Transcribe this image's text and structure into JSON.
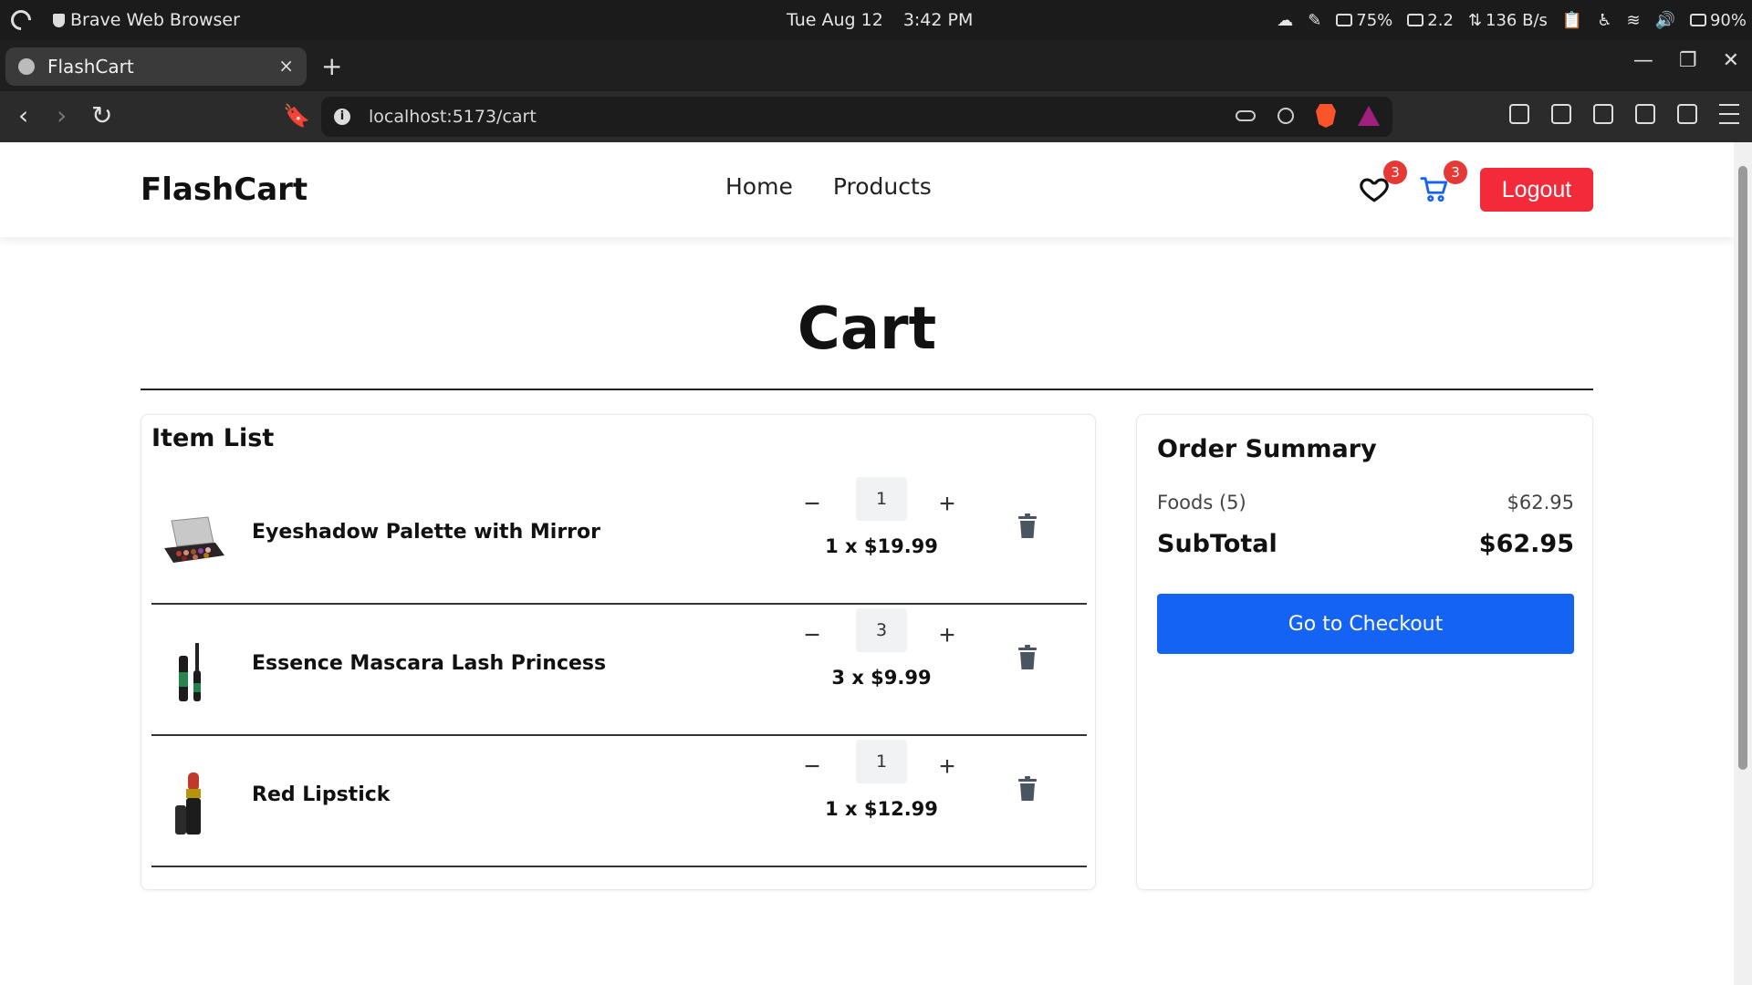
{
  "os": {
    "app_name": "Brave Web Browser",
    "date": "Tue Aug 12",
    "time": "3:42 PM",
    "battery_indicator": "75%",
    "load": "2.2",
    "network": "136 B/s",
    "battery": "90%"
  },
  "browser": {
    "tab_title": "FlashCart",
    "tab_close": "×",
    "new_tab": "+",
    "url": "localhost:5173/cart"
  },
  "header": {
    "brand": "FlashCart",
    "nav": [
      "Home",
      "Products"
    ],
    "wishlist_count": "3",
    "cart_count": "3",
    "logout_label": "Logout"
  },
  "page": {
    "title": "Cart"
  },
  "item_list": {
    "title": "Item List",
    "items": [
      {
        "name": "Eyeshadow Palette with Mirror",
        "qty": "1",
        "price_line": "1 x $19.99"
      },
      {
        "name": "Essence Mascara Lash Princess",
        "qty": "3",
        "price_line": "3 x $9.99"
      },
      {
        "name": "Red Lipstick",
        "qty": "1",
        "price_line": "1 x $12.99"
      }
    ],
    "minus_label": "−",
    "plus_label": "+"
  },
  "summary": {
    "title": "Order Summary",
    "foods_label": "Foods (5)",
    "foods_value": "$62.95",
    "subtotal_label": "SubTotal",
    "subtotal_value": "$62.95",
    "checkout_label": "Go to Checkout"
  },
  "colors": {
    "logout_bg": "#f22a3a",
    "checkout_bg": "#1463f3",
    "badge_bg": "#e53935",
    "cart_icon": "#1463f3"
  }
}
